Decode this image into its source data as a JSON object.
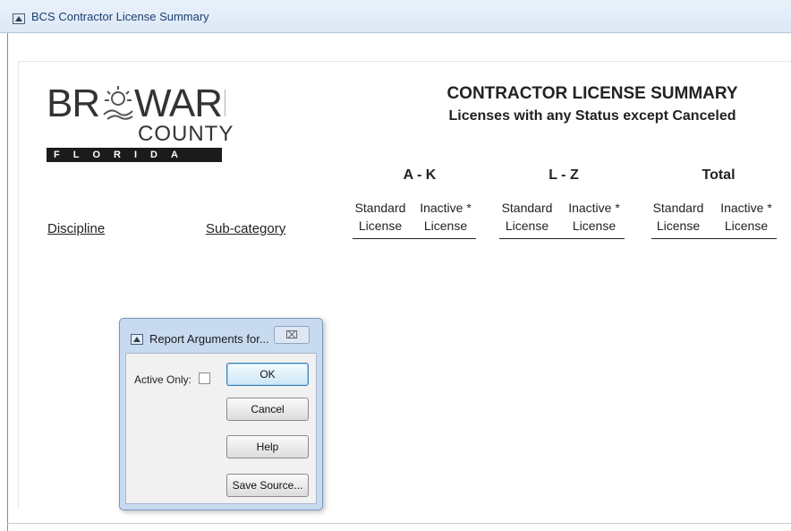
{
  "window": {
    "title": "BCS Contractor License Summary"
  },
  "logo": {
    "brand_word": "BR WARD",
    "county_word": "COUNTY",
    "state_word": "FLORIDA"
  },
  "report": {
    "title": "CONTRACTOR LICENSE SUMMARY",
    "subtitle": "Licenses with any Status except Canceled",
    "groups": [
      {
        "label": "A - K",
        "columns": [
          {
            "line1": "Standard",
            "line2": "License"
          },
          {
            "line1": "Inactive *",
            "line2": "License"
          }
        ]
      },
      {
        "label": "L - Z",
        "columns": [
          {
            "line1": "Standard",
            "line2": "License"
          },
          {
            "line1": "Inactive *",
            "line2": "License"
          }
        ]
      },
      {
        "label": "Total",
        "columns": [
          {
            "line1": "Standard",
            "line2": "License"
          },
          {
            "line1": "Inactive *",
            "line2": "License"
          }
        ]
      }
    ],
    "row_headers": {
      "discipline": "Discipline",
      "subcategory": "Sub-category"
    }
  },
  "dialog": {
    "title": "Report Arguments for...",
    "close_glyph": "⌧",
    "active_only_label": "Active Only:",
    "active_only_checked": false,
    "buttons": {
      "ok": "OK",
      "cancel": "Cancel",
      "help": "Help",
      "save_source": "Save Source..."
    }
  }
}
